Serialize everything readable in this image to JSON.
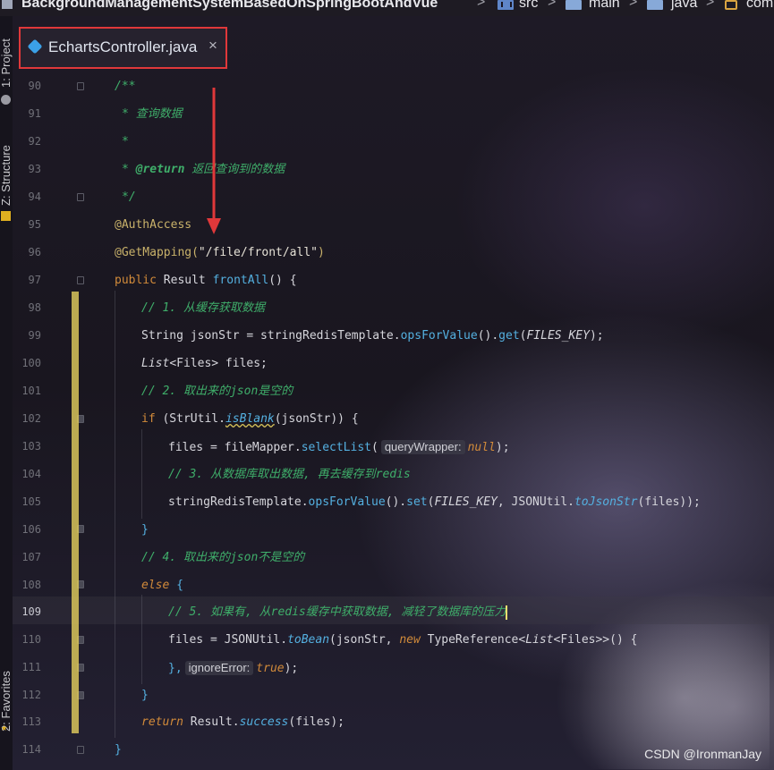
{
  "breadcrumb": {
    "project": "BackgroundManagementSystemBasedOnSpringBootAndVue",
    "items": [
      "src",
      "main",
      "java",
      "com"
    ]
  },
  "editor": {
    "tab_title": "EchartsController.java",
    "tab_close": "×",
    "current_line": 109,
    "lines": [
      {
        "n": "90"
      },
      {
        "n": "91"
      },
      {
        "n": "92"
      },
      {
        "n": "93"
      },
      {
        "n": "94"
      },
      {
        "n": "95"
      },
      {
        "n": "96"
      },
      {
        "n": "97"
      },
      {
        "n": "98"
      },
      {
        "n": "99"
      },
      {
        "n": "100"
      },
      {
        "n": "101"
      },
      {
        "n": "102"
      },
      {
        "n": "103"
      },
      {
        "n": "104"
      },
      {
        "n": "105"
      },
      {
        "n": "106"
      },
      {
        "n": "107"
      },
      {
        "n": "108"
      },
      {
        "n": "109"
      },
      {
        "n": "110"
      },
      {
        "n": "111"
      },
      {
        "n": "112"
      },
      {
        "n": "113"
      },
      {
        "n": "114"
      }
    ],
    "code": {
      "l90": "/**",
      "l91": "* 查询数据",
      "l92": "*",
      "l93_tag": "@return",
      "l93_text": "返回查询到的数据",
      "l94": "*/",
      "l95": "@AuthAccess",
      "l96_anno": "@GetMapping(",
      "l96_str": "\"/file/front/all\"",
      "l96_end": ")",
      "l97_kw": "public",
      "l97_type": "Result",
      "l97_method": "frontAll",
      "l97_end": "() {",
      "l98": "// 1. 从缓存获取数据",
      "l99_a": "String jsonStr = stringRedisTemplate.",
      "l99_m1": "opsForValue",
      "l99_b": "().",
      "l99_m2": "get",
      "l99_c": "(",
      "l99_const": "FILES_KEY",
      "l99_d": ");",
      "l100_a": "List",
      "l100_b": "<Files> files;",
      "l101": "// 2. 取出来的json是空的",
      "l102_kw": "if",
      "l102_a": " (StrUtil.",
      "l102_m": "isBlank",
      "l102_b": "(jsonStr)) {",
      "l103_a": "files = fileMapper.",
      "l103_m": "selectList",
      "l103_b": "(",
      "l103_hint": "queryWrapper:",
      "l103_kw": "null",
      "l103_c": ");",
      "l104": "// 3. 从数据库取出数据, 再去缓存到redis",
      "l105_a": "stringRedisTemplate.",
      "l105_m1": "opsForValue",
      "l105_b": "().",
      "l105_m2": "set",
      "l105_c": "(",
      "l105_const": "FILES_KEY",
      "l105_d": ", JSONUtil.",
      "l105_m3": "toJsonStr",
      "l105_e": "(files));",
      "l106": "}",
      "l107": "// 4. 取出来的json不是空的",
      "l108_kw": "else",
      "l108_b": " {",
      "l109": "// 5. 如果有, 从redis缓存中获取数据, 减轻了数据库的压力",
      "l110_a": "files = JSONUtil.",
      "l110_m": "toBean",
      "l110_b": "(jsonStr, ",
      "l110_kw": "new",
      "l110_c": " TypeReference<",
      "l110_d": "List",
      "l110_e": "<Files>>() {",
      "l111_a": "},",
      "l111_hint": "ignoreError:",
      "l111_kw": "true",
      "l111_b": ");",
      "l112": "}",
      "l113_kw": "return",
      "l113_a": " Result.",
      "l113_m": "success",
      "l113_b": "(files);",
      "l114": "}"
    }
  },
  "tool_windows": {
    "project": "1: Project",
    "structure": "Z: Structure",
    "favorites": "2: Favorites"
  },
  "watermark": "CSDN @IronmanJay",
  "colors": {
    "comment": "#3fae6a",
    "keyword": "#d18a3a",
    "method": "#54b0e0",
    "annotation": "#c9b26a",
    "highlight_box": "#e0383a"
  }
}
